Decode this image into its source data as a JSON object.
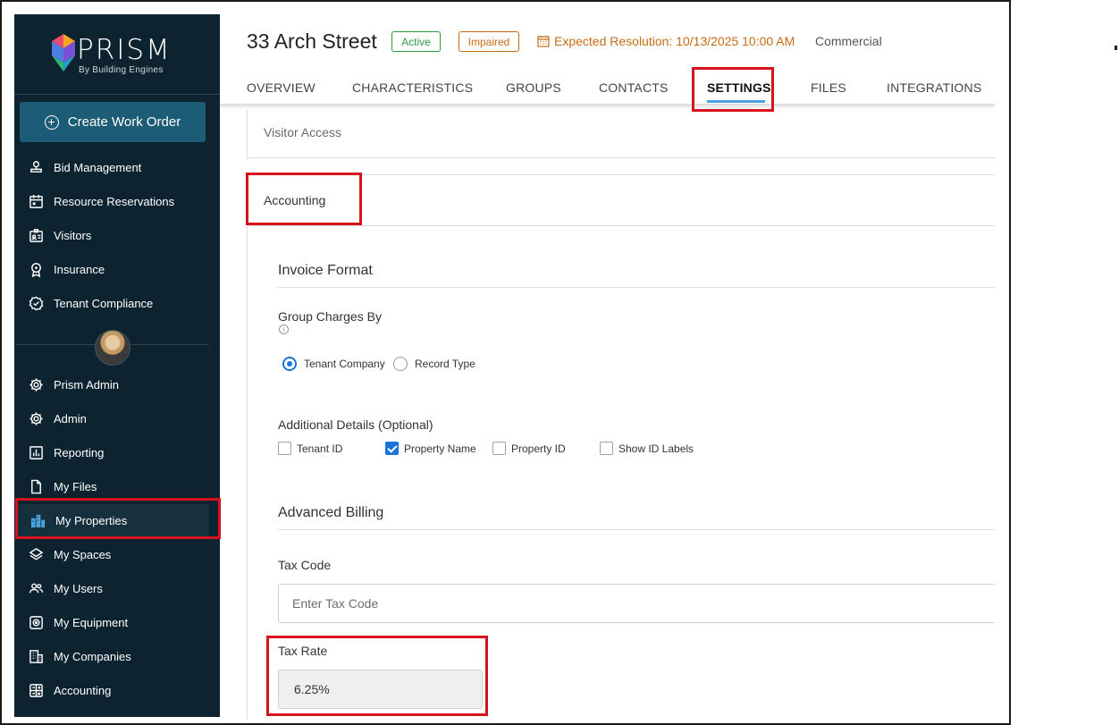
{
  "sidebar": {
    "logo_text": "PRISM",
    "logo_sub": "By Building Engines",
    "create_label": "Create Work Order",
    "top_items": [
      {
        "label": "Bid Management",
        "icon": "stamp-icon"
      },
      {
        "label": "Resource Reservations",
        "icon": "calendar-icon"
      },
      {
        "label": "Visitors",
        "icon": "id-badge-icon"
      },
      {
        "label": "Insurance",
        "icon": "award-icon"
      },
      {
        "label": "Tenant Compliance",
        "icon": "verified-icon"
      }
    ],
    "bottom_items": [
      {
        "label": "Prism Admin",
        "icon": "gear-icon"
      },
      {
        "label": "Admin",
        "icon": "gear-icon"
      },
      {
        "label": "Reporting",
        "icon": "bar-chart-icon"
      },
      {
        "label": "My Files",
        "icon": "file-icon"
      },
      {
        "label": "My Properties",
        "icon": "buildings-icon",
        "active": true
      },
      {
        "label": "My Spaces",
        "icon": "layers-icon"
      },
      {
        "label": "My Users",
        "icon": "users-icon"
      },
      {
        "label": "My Equipment",
        "icon": "equipment-icon"
      },
      {
        "label": "My Companies",
        "icon": "office-icon"
      },
      {
        "label": "Accounting",
        "icon": "calculator-icon"
      }
    ]
  },
  "header": {
    "title": "33 Arch Street",
    "status_active": "Active",
    "status_impaired": "Impaired",
    "expected_resolution": "Expected Resolution: 10/13/2025 10:00 AM",
    "property_type": "Commercial"
  },
  "tabs": [
    "OVERVIEW",
    "CHARACTERISTICS",
    "GROUPS",
    "CONTACTS",
    "SETTINGS",
    "FILES",
    "INTEGRATIONS"
  ],
  "active_tab": "SETTINGS",
  "settings": {
    "visitor_access": "Visitor Access",
    "accounting": "Accounting",
    "invoice_format": "Invoice Format",
    "group_charges_by": "Group Charges By",
    "radio_options": [
      {
        "label": "Tenant Company",
        "selected": true
      },
      {
        "label": "Record Type",
        "selected": false
      }
    ],
    "additional_details": "Additional Details (Optional)",
    "checkboxes": [
      {
        "label": "Tenant ID",
        "checked": false
      },
      {
        "label": "Property Name",
        "checked": true
      },
      {
        "label": "Property ID",
        "checked": false
      },
      {
        "label": "Show ID Labels",
        "checked": false
      }
    ],
    "advanced_billing": "Advanced Billing",
    "tax_code_label": "Tax Code",
    "tax_code_placeholder": "Enter Tax Code",
    "tax_rate_label": "Tax Rate",
    "tax_rate_value": "6.25%"
  },
  "colors": {
    "sidebar_bg": "#0d2430",
    "create_button": "#1d5c77",
    "active_green": "#2e9a3f",
    "impaired_orange": "#c66d16",
    "highlight_red": "#d6121e",
    "accent_blue": "#1a73d8"
  }
}
